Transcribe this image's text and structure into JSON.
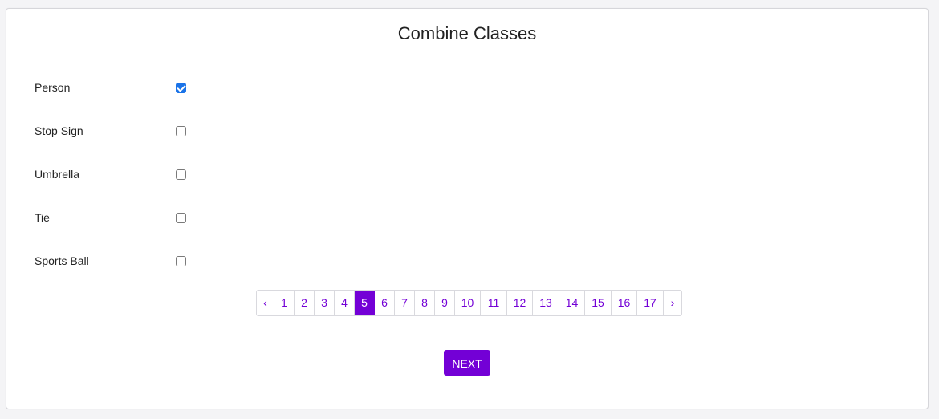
{
  "title": "Combine Classes",
  "classes": [
    {
      "label": "Person",
      "checked": true
    },
    {
      "label": "Stop Sign",
      "checked": false
    },
    {
      "label": "Umbrella",
      "checked": false
    },
    {
      "label": "Tie",
      "checked": false
    },
    {
      "label": "Sports Ball",
      "checked": false
    }
  ],
  "pagination": {
    "prev": "‹",
    "next": "›",
    "pages": [
      "1",
      "2",
      "3",
      "4",
      "5",
      "6",
      "7",
      "8",
      "9",
      "10",
      "11",
      "12",
      "13",
      "14",
      "15",
      "16",
      "17"
    ],
    "active": "5"
  },
  "next_button": "NEXT",
  "colors": {
    "accent": "#7300d6",
    "checkbox_checked": "#1a73e8"
  }
}
